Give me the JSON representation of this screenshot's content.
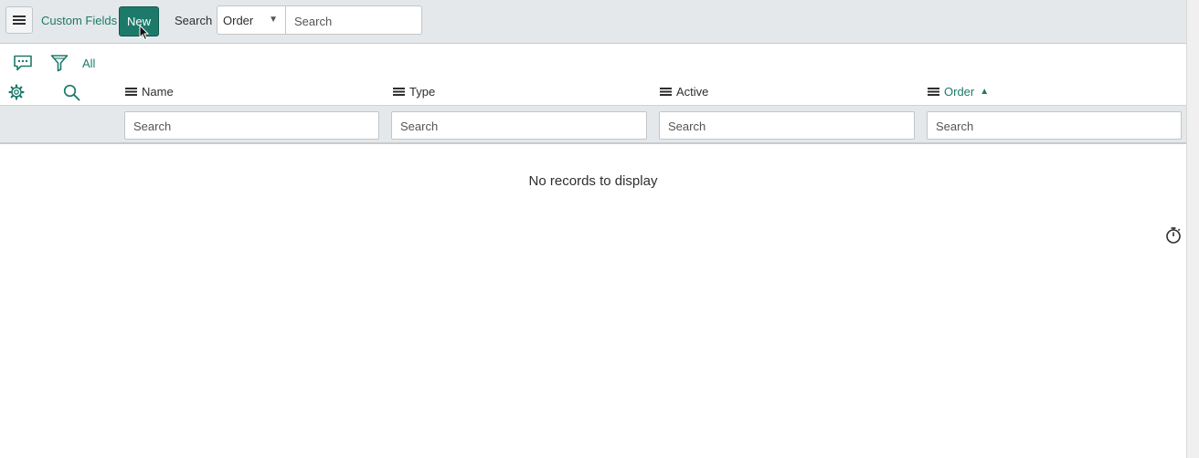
{
  "header": {
    "title": "Custom Fields",
    "new_label": "New",
    "search_label": "Search",
    "search_field_selected": "Order",
    "search_placeholder": "Search"
  },
  "toolbar": {
    "filter_all_label": "All"
  },
  "table": {
    "columns": [
      {
        "label": "Name",
        "sorted": false
      },
      {
        "label": "Type",
        "sorted": false
      },
      {
        "label": "Active",
        "sorted": false
      },
      {
        "label": "Order",
        "sorted": true,
        "sort_direction": "ascending"
      }
    ],
    "column_search_placeholder": "Search",
    "empty_message": "No records to display"
  },
  "colors": {
    "accent": "#1d7a6b",
    "header_bg": "#e5e8ea"
  }
}
